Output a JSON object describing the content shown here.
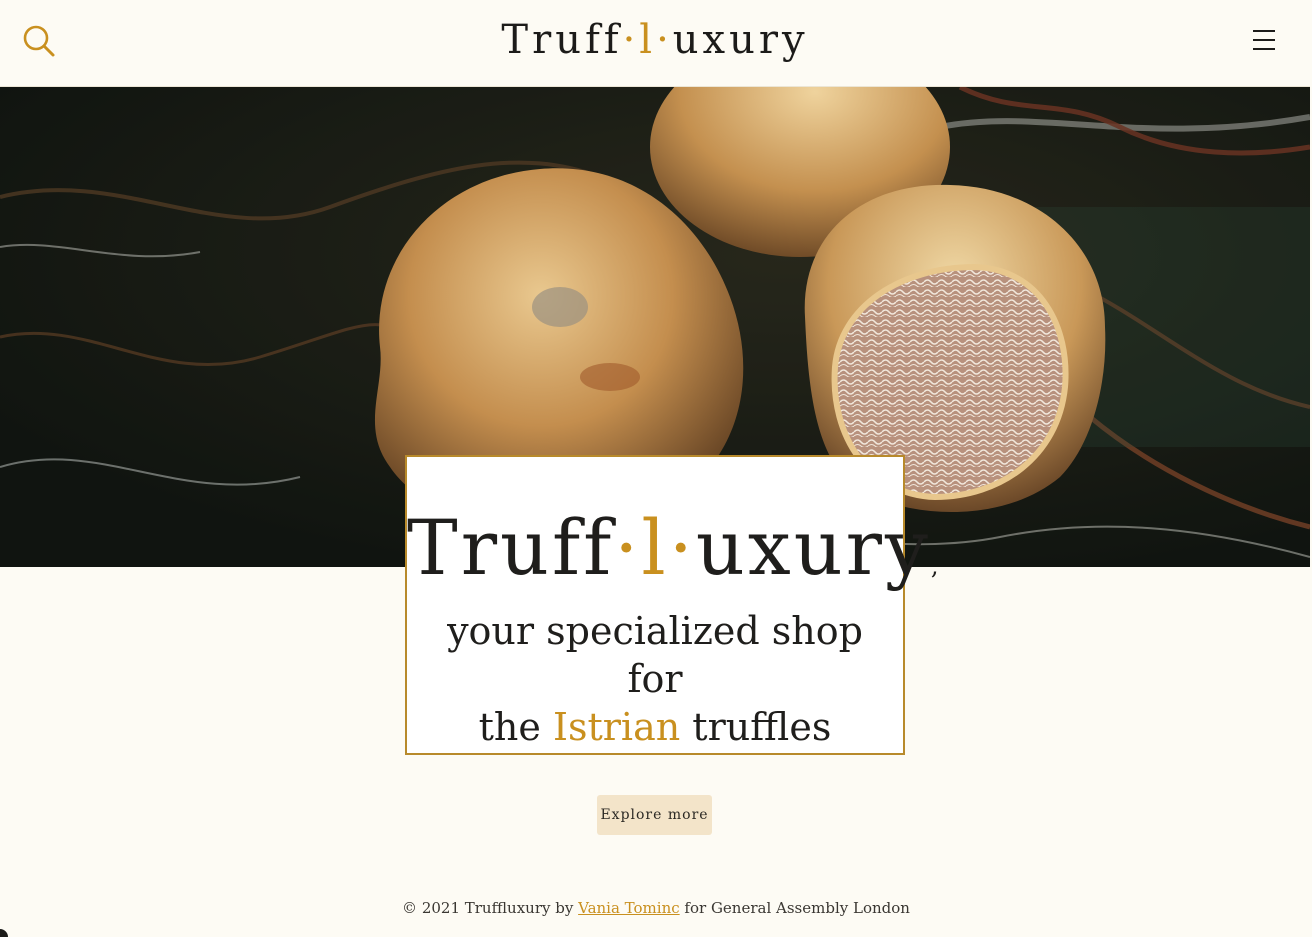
{
  "header": {
    "logo": {
      "part1": "Truff",
      "dot1": "·",
      "l": "l",
      "dot2": "·",
      "part2": "uxury"
    },
    "search_icon": "search-icon",
    "menu_icon": "hamburger-menu-icon"
  },
  "hero": {
    "image": "photo of three white truffles on dark marble, one sliced open"
  },
  "card": {
    "brand": {
      "part1": "Truff",
      "dot1": "·",
      "l": "l",
      "dot2": "·",
      "part2": "uxury",
      "comma": ","
    },
    "tagline": {
      "line1": "your specialized shop for",
      "the": "the",
      "istrian": "Istrian",
      "truffles": "truffles"
    }
  },
  "cta": {
    "label": "Explore more"
  },
  "footer": {
    "prefix": "© 2021 Truff",
    "l": "l",
    "brand_rest": "uxury by",
    "author": "Vania Tominc",
    "suffix": "for General Assembly London"
  },
  "colors": {
    "accent": "#c9901f",
    "background": "#fdfbf4",
    "button": "#f3e4c9",
    "card_border": "#b88a2b",
    "text": "#1f1e1c"
  }
}
